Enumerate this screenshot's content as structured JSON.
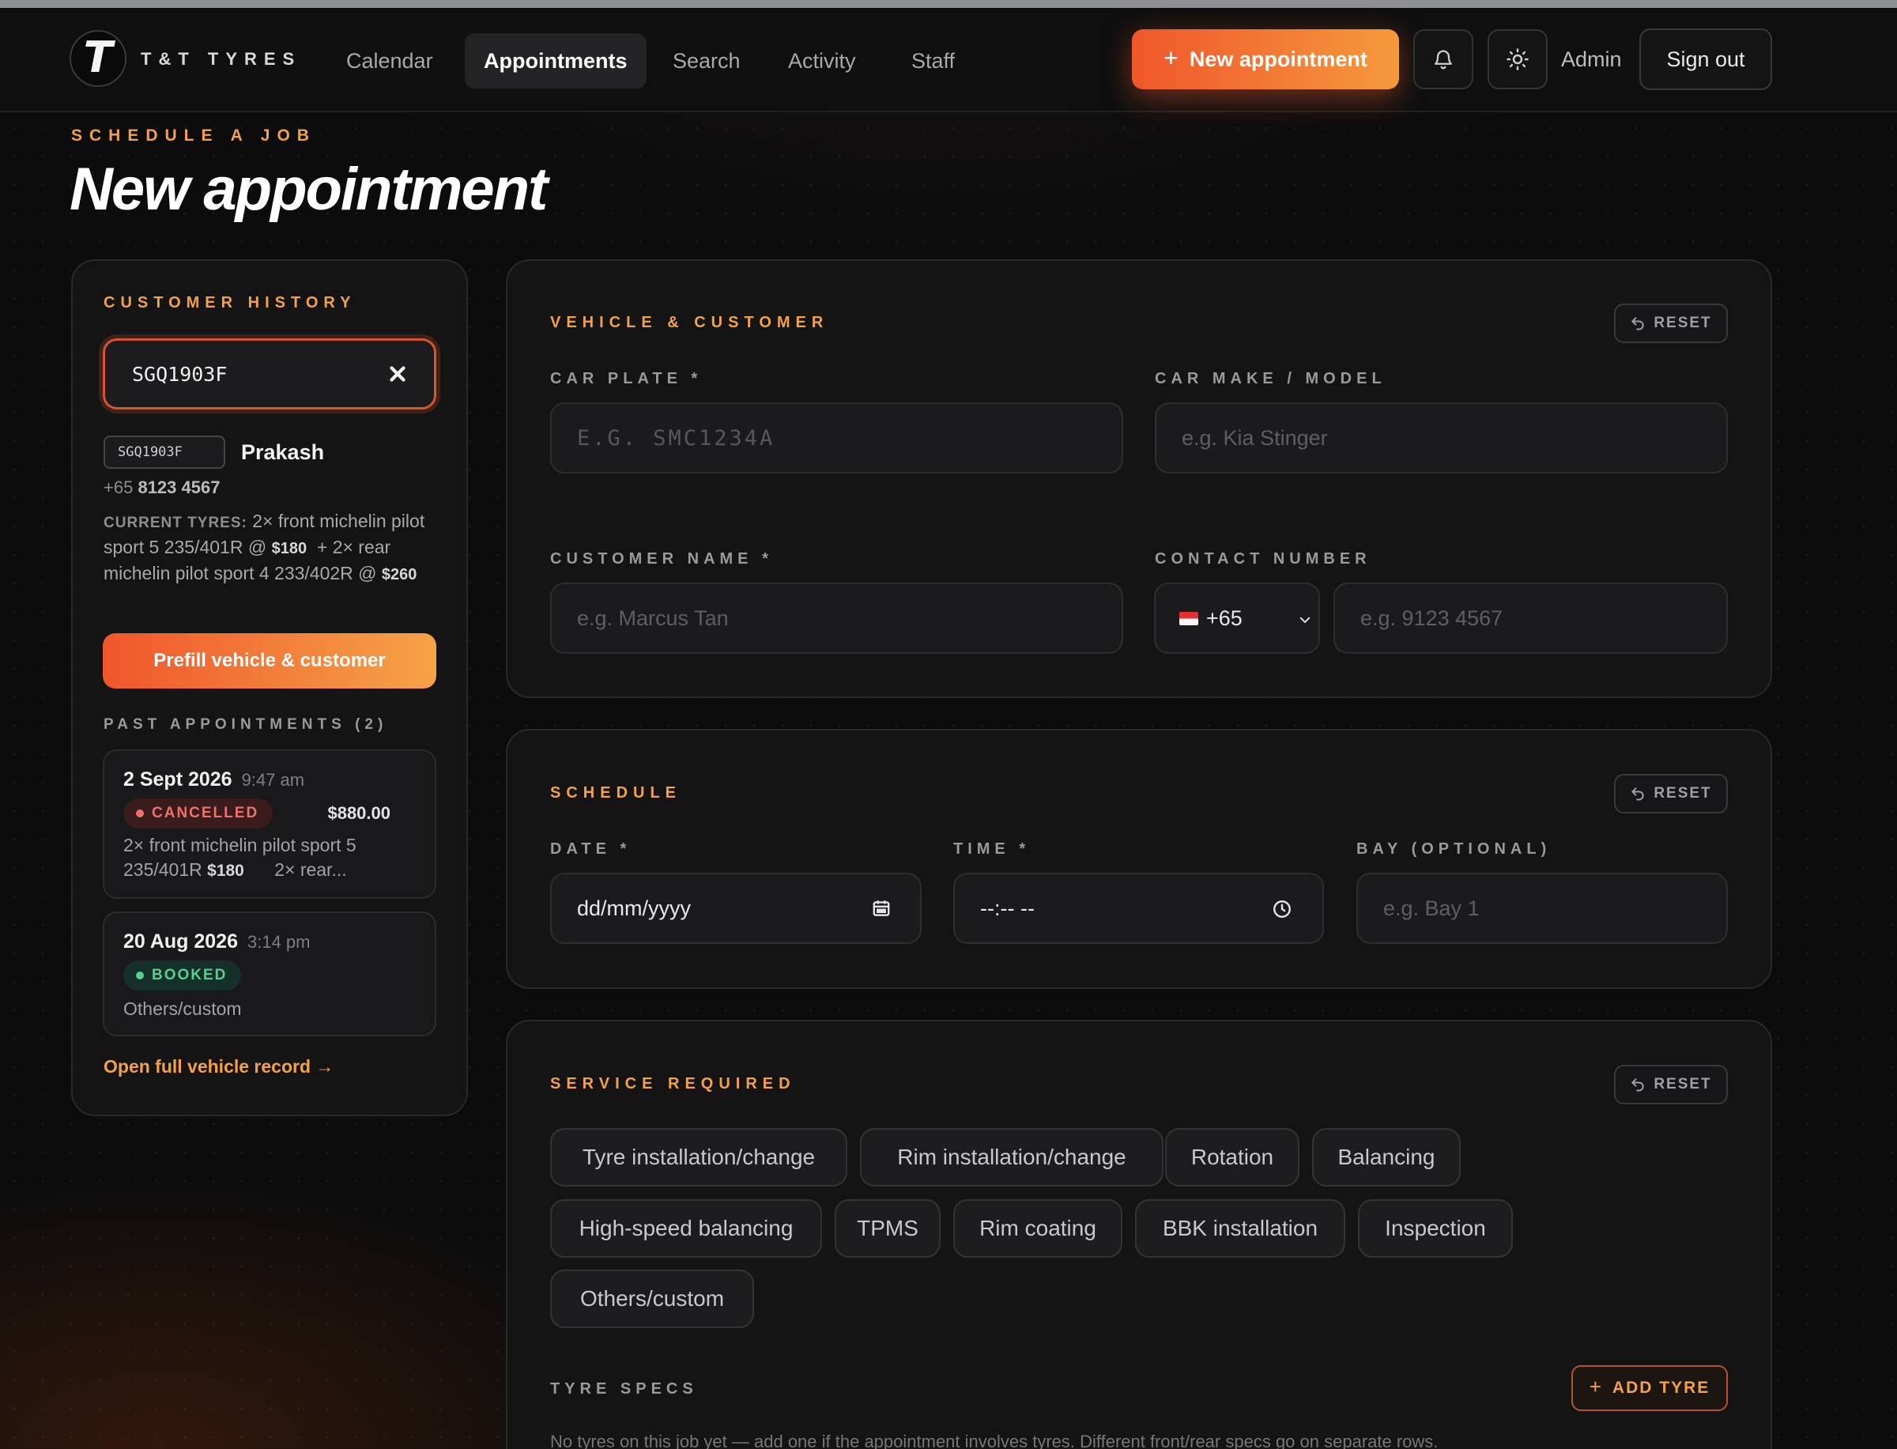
{
  "nav": {
    "brand": "T&T TYRES",
    "logo_letter": "T",
    "links": [
      "Calendar",
      "Appointments",
      "Search",
      "Activity",
      "Staff"
    ],
    "active": "Appointments",
    "new_button": "New appointment",
    "admin_label": "Admin",
    "sign_out": "Sign out",
    "icons": [
      "bell-icon",
      "sun-icon"
    ]
  },
  "page": {
    "eyebrow": "SCHEDULE A JOB",
    "title": "New appointment"
  },
  "history": {
    "label": "CUSTOMER HISTORY",
    "search_value": "SGQ1903F",
    "plate": "SGQ1903F",
    "name": "Prakash",
    "phone_prefix": "+65",
    "phone": "8123 4567",
    "tyres_caption": "CURRENT TYRES:",
    "tyres_part1": "2× front michelin pilot sport 5 235/401R @",
    "tyres_price1": "$180",
    "tyres_part2": "+ 2× rear michelin pilot sport 4 233/402R @",
    "tyres_price2": "$260",
    "prefill_button": "Prefill vehicle & customer",
    "past_label": "PAST APPOINTMENTS (2)",
    "appointments": [
      {
        "date": "2 Sept 2026",
        "time": "9:47 am",
        "status": "CANCELLED",
        "amount": "$880.00",
        "desc1": "2× front michelin pilot sport 5 235/401R",
        "desc_price": "$180",
        "desc2": "2× rear..."
      },
      {
        "date": "20 Aug 2026",
        "time": "3:14 pm",
        "status": "BOOKED",
        "desc": "Others/custom"
      }
    ],
    "open_link": "Open full vehicle record →",
    "colors": {
      "accent": "#f3a14a",
      "cancelled": "#f0706b",
      "booked": "#57d08f"
    }
  },
  "vehicle": {
    "label": "VEHICLE & CUSTOMER",
    "reset": "RESET",
    "car_plate_label": "CAR PLATE *",
    "car_plate_placeholder": "E.G. SMC1234A",
    "car_make_label": "CAR MAKE / MODEL",
    "car_make_placeholder": "e.g. Kia Stinger",
    "customer_name_label": "CUSTOMER NAME *",
    "customer_name_placeholder": "e.g. Marcus Tan",
    "contact_label": "CONTACT NUMBER",
    "country_code": "+65",
    "contact_placeholder": "e.g. 9123 4567"
  },
  "schedule": {
    "label": "SCHEDULE",
    "reset": "RESET",
    "date_label": "DATE *",
    "date_placeholder": "dd/mm/yyyy",
    "time_label": "TIME *",
    "time_placeholder": "--:-- --",
    "bay_label": "BAY (OPTIONAL)",
    "bay_placeholder": "e.g. Bay 1"
  },
  "service": {
    "label": "SERVICE REQUIRED",
    "reset": "RESET",
    "options": [
      "Tyre installation/change",
      "Rim installation/change",
      "Rotation",
      "Balancing",
      "High-speed balancing",
      "TPMS",
      "Rim coating",
      "BBK installation",
      "Inspection",
      "Others/custom"
    ],
    "tyre_specs_label": "TYRE SPECS",
    "add_tyre": "ADD TYRE",
    "empty_note": "No tyres on this job yet — add one if the appointment involves tyres. Different front/rear specs go on separate rows."
  }
}
